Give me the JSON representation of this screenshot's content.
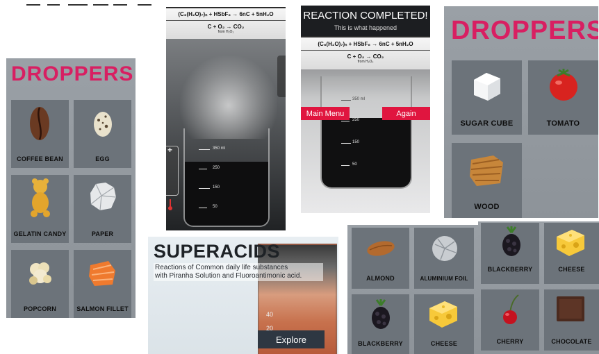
{
  "screen_droppers_1": {
    "title": "DROPPERS",
    "items": [
      {
        "label": "COFFEE BEAN",
        "icon": "coffee-bean-icon"
      },
      {
        "label": "EGG",
        "icon": "egg-icon"
      },
      {
        "label": "GELATIN CANDY",
        "icon": "gummy-bear-icon"
      },
      {
        "label": "PAPER",
        "icon": "crumpled-paper-icon"
      },
      {
        "label": "POPCORN",
        "icon": "popcorn-icon"
      },
      {
        "label": "SALMON FILLET",
        "icon": "salmon-icon"
      }
    ]
  },
  "screen_reaction_live": {
    "equation_1": "(C₆(H₂O)₇)ₙ + HSbF₆ → 6nC + 5nH₂O",
    "equation_2": "C + O₂ → CO₂",
    "equation_2_sub": "from H₂O₂",
    "beaker_marks": [
      "350 ml",
      "250",
      "150",
      "50"
    ],
    "plus_symbol": "+"
  },
  "screen_reaction_completed": {
    "title": "REACTION COMPLETED!",
    "subtitle": "This is what happened",
    "equation_1": "(C₆(H₂O)₇)ₙ + HSbF₆ → 6nC + 5nH₂O",
    "equation_2": "C + O₂ → CO₂",
    "equation_2_sub": "from H₂O₂",
    "main_menu_label": "Main Menu",
    "again_label": "Again",
    "beaker_marks": [
      "350 ml",
      "250",
      "150",
      "50"
    ]
  },
  "screen_droppers_2": {
    "title": "DROPPERS",
    "items": [
      {
        "label": "SUGAR CUBE",
        "icon": "sugar-cube-icon"
      },
      {
        "label": "TOMATO",
        "icon": "tomato-icon"
      },
      {
        "label": "WOOD",
        "icon": "wood-icon"
      }
    ]
  },
  "screen_superacids": {
    "title": "SUPERACIDS",
    "description_line1": "Reactions of Common daily life substances",
    "description_line2": "with Piranha Solution and Fluoroantimonic acid.",
    "explore_label": "Explore",
    "beaker_marks": [
      "40",
      "20"
    ]
  },
  "screen_droppers_3": {
    "items": [
      {
        "label": "ALMOND",
        "icon": "almond-icon"
      },
      {
        "label": "ALUMINIUM FOIL",
        "icon": "aluminium-foil-icon"
      },
      {
        "label": "BLACKBERRY",
        "icon": "blackberry-icon"
      },
      {
        "label": "CHEESE",
        "icon": "cheese-icon"
      }
    ]
  },
  "screen_droppers_4": {
    "items": [
      {
        "label": "BLACKBERRY",
        "icon": "blackberry-icon"
      },
      {
        "label": "CHEESE",
        "icon": "cheese-icon"
      },
      {
        "label": "CHERRY",
        "icon": "cherry-icon"
      },
      {
        "label": "CHOCOLATE",
        "icon": "chocolate-icon"
      }
    ]
  },
  "colors": {
    "accent_pink": "#d81f62",
    "button_red": "#e0153f",
    "tile_gray": "#6c737a",
    "panel_gray": "#9aa0a6"
  }
}
